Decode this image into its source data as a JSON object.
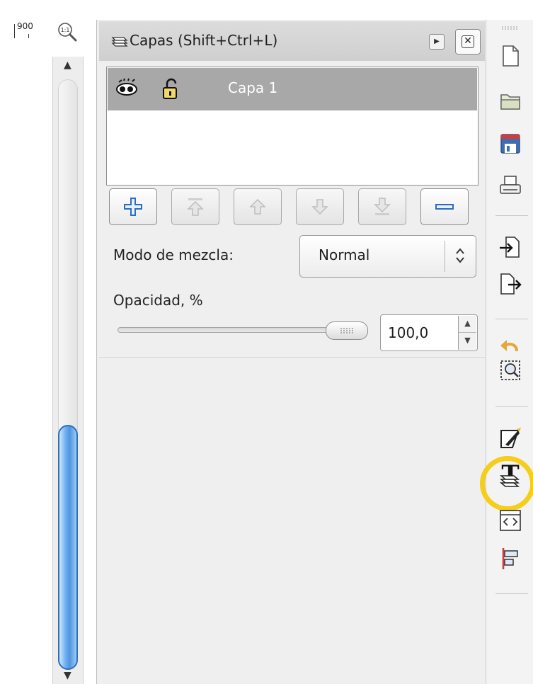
{
  "ruler": {
    "label": "900"
  },
  "zoom": {
    "label": "1:1"
  },
  "panel": {
    "title": "Capas (Shift+Ctrl+L)",
    "layers": [
      {
        "name": "Capa 1"
      }
    ],
    "blend": {
      "label": "Modo de mezcla:",
      "value": "Normal"
    },
    "opacity": {
      "label": "Opacidad, %",
      "value": "100,0",
      "level_percent": 100
    }
  },
  "icons": {
    "title": "layers-icon",
    "play": "play-icon",
    "close": "close-icon",
    "eye": "eye-icon",
    "lock": "unlock-icon"
  },
  "colors": {
    "selection_row": "#a8a8a8",
    "accent_blue": "#2c6ebd",
    "scroll_thumb": "#4e95de",
    "highlight": "#f6cd1a"
  }
}
